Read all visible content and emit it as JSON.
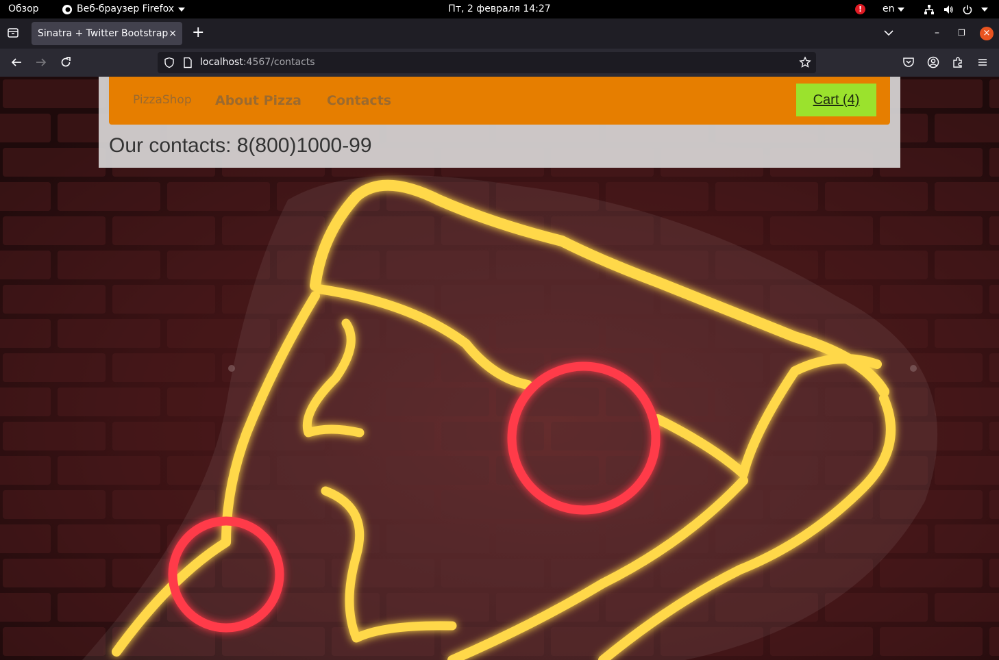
{
  "system_bar": {
    "overview": "Обзор",
    "app_name": "Веб-браузер Firefox",
    "clock": "Пт, 2 февраля  14:27",
    "alert": "!",
    "keyboard_layout": "en"
  },
  "browser": {
    "tab_title": "Sinatra + Twitter Bootstrap",
    "tab_close": "×",
    "new_tab": "+",
    "url_host": "localhost",
    "url_path": ":4567/contacts"
  },
  "site": {
    "brand": "PizzaShop",
    "nav": {
      "about": "About Pizza",
      "contacts": "Contacts"
    },
    "cart_label": "Cart (4)",
    "contacts_text": "Our contacts: 8(800)1000-99"
  },
  "colors": {
    "navbar_bg": "#e67e00",
    "cart_bg": "#9be22d",
    "nav_link": "#9b6a2f",
    "neon_yellow": "#ffd84a",
    "neon_red": "#ff3b4a"
  }
}
